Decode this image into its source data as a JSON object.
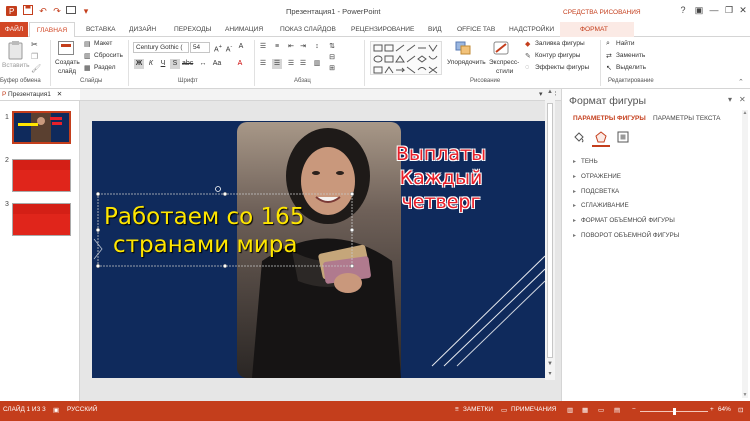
{
  "titlebar": {
    "title": "Презентация1 - PowerPoint",
    "contextual_title": "СРЕДСТВА РИСОВАНИЯ",
    "help": "?",
    "minimize": "—",
    "restore": "❐",
    "close": "✕"
  },
  "tabs": {
    "file": "ФАЙЛ",
    "home": "ГЛАВНАЯ",
    "insert": "ВСТАВКА",
    "design": "ДИЗАЙН",
    "transitions": "ПЕРЕХОДЫ",
    "animations": "АНИМАЦИЯ",
    "slideshow": "ПОКАЗ СЛАЙДОВ",
    "review": "РЕЦЕНЗИРОВАНИЕ",
    "view": "ВИД",
    "office_tab": "OFFICE TAB",
    "addins": "НАДСТРОЙКИ",
    "format": "ФОРМАТ"
  },
  "ribbon": {
    "clipboard": {
      "paste": "Вставить",
      "label": "Буфер обмена"
    },
    "slides": {
      "new_slide": "Создать",
      "new_slide2": "слайд",
      "layout": "Макет",
      "reset": "Сбросить",
      "section": "Раздел",
      "label": "Слайды"
    },
    "font": {
      "name": "Century Gothic (",
      "size": "54",
      "label": "Шрифт"
    },
    "paragraph": {
      "label": "Абзац"
    },
    "drawing": {
      "arrange": "Упорядочить",
      "quick_styles": "Экспресс-",
      "quick_styles2": "стили",
      "fill": "Заливка фигуры",
      "outline": "Контур фигуры",
      "effects": "Эффекты фигуры",
      "label": "Рисование"
    },
    "editing": {
      "find": "Найти",
      "replace": "Заменить",
      "select": "Выделить",
      "label": "Редактирование"
    }
  },
  "doc_tab": "Презентация1",
  "thumbnails": [
    {
      "number": "1",
      "selected": true
    },
    {
      "number": "2",
      "selected": false
    },
    {
      "number": "3",
      "selected": false
    }
  ],
  "slide": {
    "caption_line1": "Работаем со 165",
    "caption_line2": "странами мира",
    "promo_line1": "Выплаты",
    "promo_line2": "Каждый",
    "promo_line3": "четверг"
  },
  "format_pane": {
    "title": "Формат фигуры",
    "tab_shape": "ПАРАМЕТРЫ ФИГУРЫ",
    "tab_text": "ПАРАМЕТРЫ ТЕКСТА",
    "sections": [
      "ТЕНЬ",
      "ОТРАЖЕНИЕ",
      "ПОДСВЕТКА",
      "СГЛАЖИВАНИЕ",
      "ФОРМАТ ОБЪЕМНОЙ ФИГУРЫ",
      "ПОВОРОТ ОБЪЕМНОЙ ФИГУРЫ"
    ]
  },
  "status": {
    "slide": "СЛАЙД 1 ИЗ 3",
    "language": "РУССКИЙ",
    "notes": "ЗАМЕТКИ",
    "comments": "ПРИМЕЧАНИЯ",
    "zoom": "64%"
  },
  "colors": {
    "accent": "#c43e1c",
    "slide_bg": "#0f2a5c",
    "caption": "#ffe600",
    "promo": "#e8202a"
  }
}
